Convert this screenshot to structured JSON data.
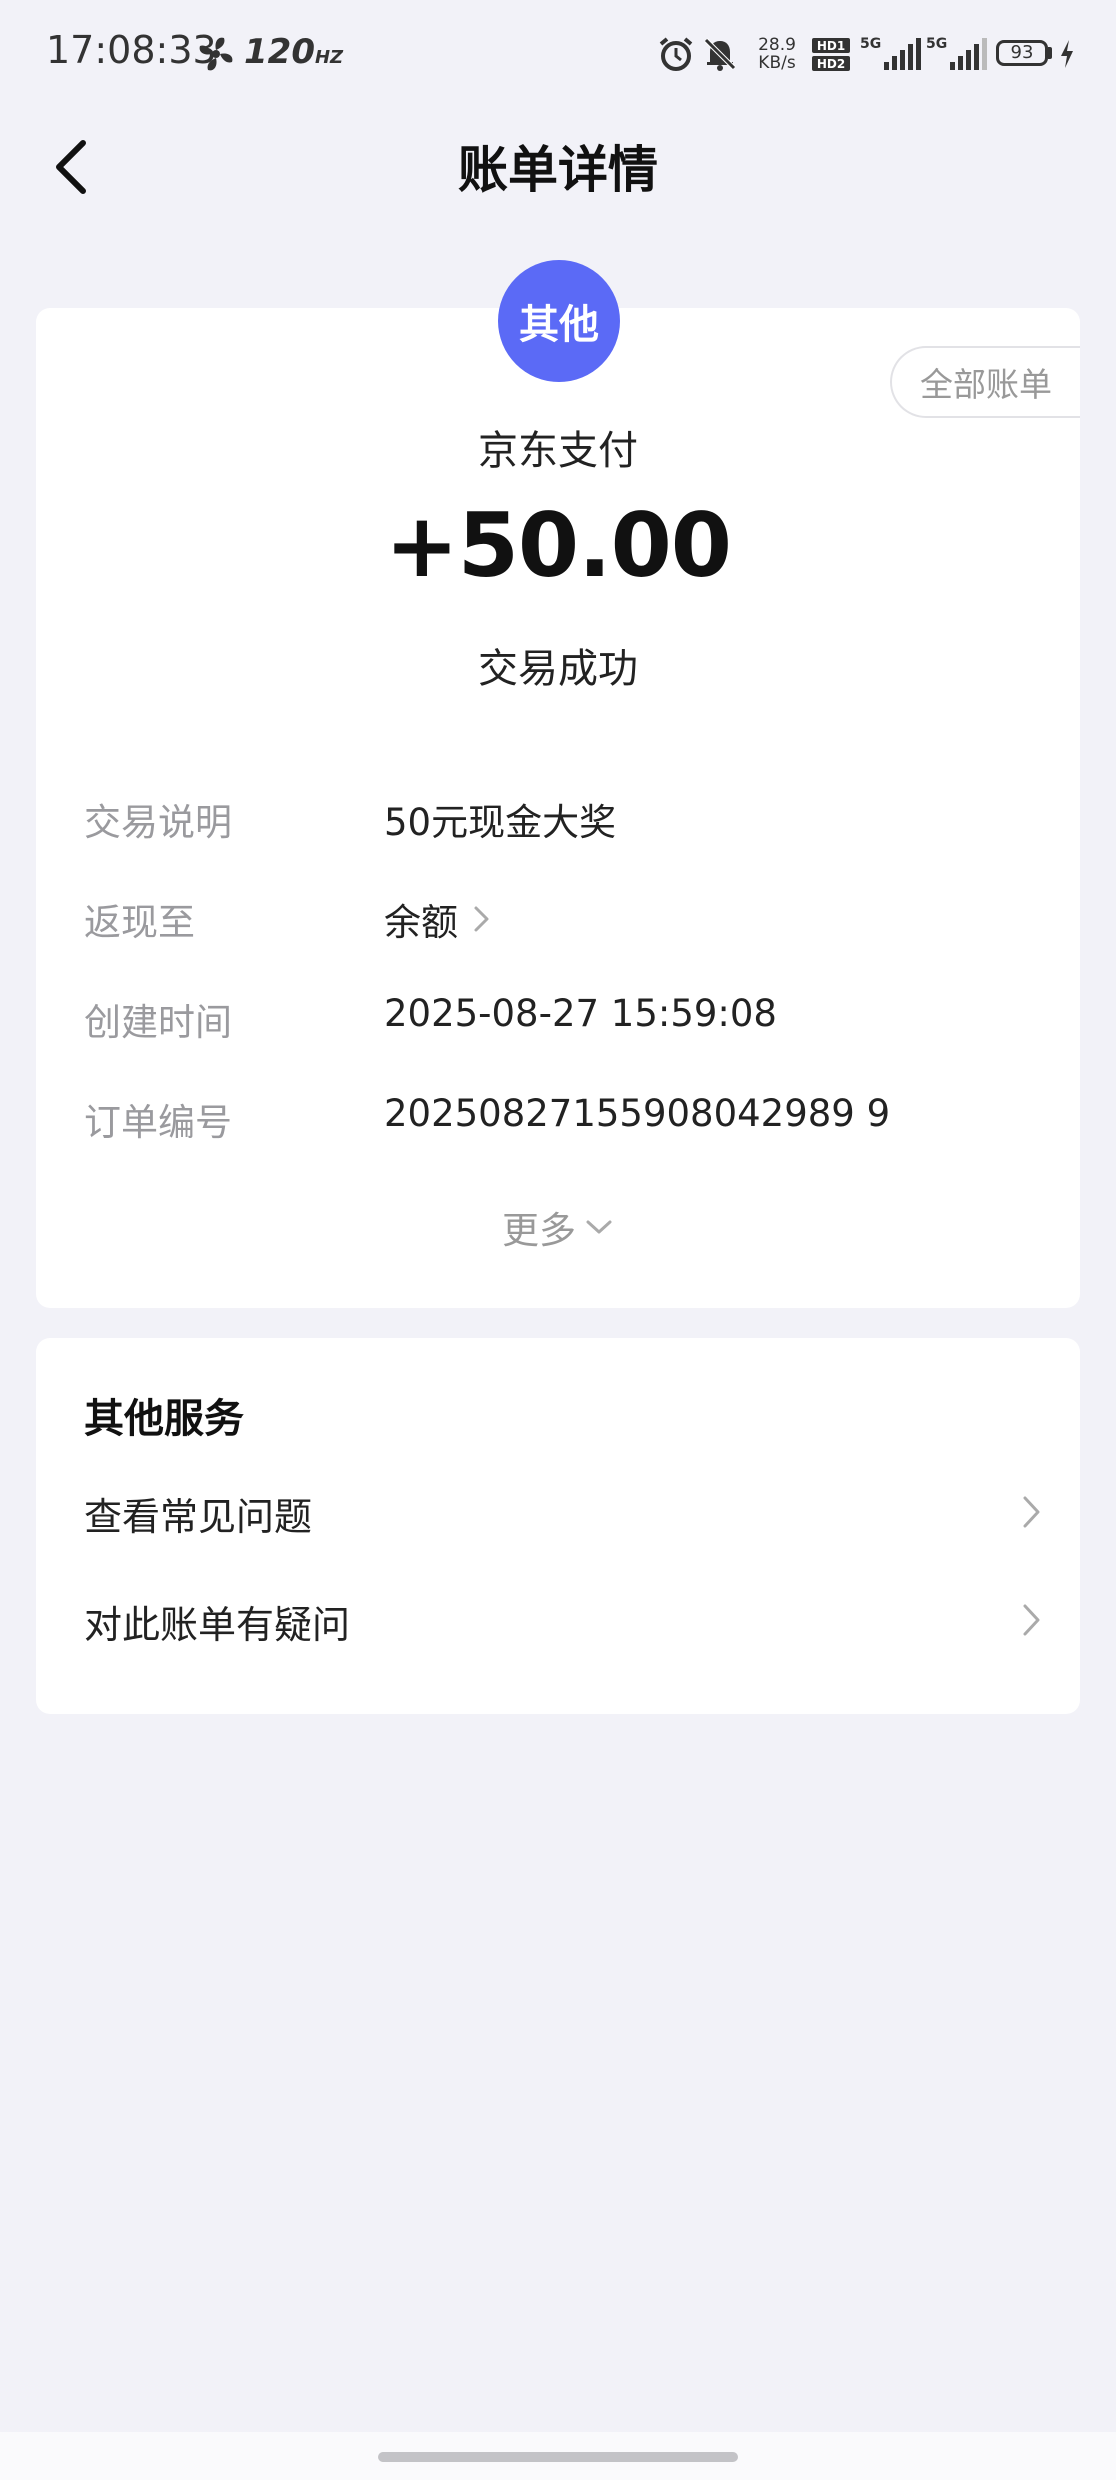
{
  "status_bar": {
    "time": "17:08:33",
    "refresh_rate": "120",
    "refresh_unit": "HZ",
    "net_speed_value": "28.9",
    "net_speed_unit": "KB/s",
    "hd_label": "HD1 HD2",
    "signal_1": "5G",
    "signal_2": "5G",
    "battery": "93"
  },
  "nav": {
    "title": "账单详情"
  },
  "bill": {
    "category": "其他",
    "all_bills_label": "全部账单",
    "merchant": "京东支付",
    "amount": "+50.00",
    "status": "交易成功",
    "details": [
      {
        "label": "交易说明",
        "value": "50元现金大奖"
      },
      {
        "label": "返现至",
        "value": "余额"
      },
      {
        "label": "创建时间",
        "value": "2025-08-27 15:59:08"
      },
      {
        "label": "订单编号",
        "value": "20250827155908042989 9"
      }
    ],
    "more_label": "更多"
  },
  "services": {
    "title": "其他服务",
    "items": [
      {
        "label": "查看常见问题"
      },
      {
        "label": "对此账单有疑问"
      }
    ]
  },
  "colors": {
    "badge": "#5b6af6",
    "background": "#f2f2f8"
  }
}
